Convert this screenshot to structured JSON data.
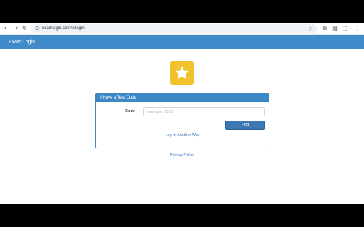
{
  "browser": {
    "url": "examlogin.com/#/login",
    "icons": [
      "back-icon",
      "forward-icon",
      "reload-icon",
      "tune-icon",
      "bookmark-star-icon",
      "translate-icon",
      "reader-icon",
      "extensions-icon",
      "menu-icon"
    ]
  },
  "header": {
    "title": "Exam Login",
    "color": "#428bca"
  },
  "logo": {
    "icon": "star-icon",
    "color": "#f0c22c"
  },
  "panel": {
    "title": "I Have a Test Code",
    "code_label": "Code",
    "code_value": "",
    "code_placeholder": "example XGC2",
    "find_label": "Find",
    "alt_link": "Log In Another Way",
    "accent": "#3c87c6"
  },
  "footer": {
    "privacy": "Privacy Policy"
  }
}
